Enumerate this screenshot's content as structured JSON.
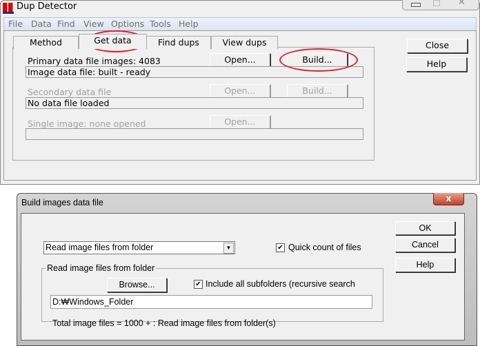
{
  "main_window": {
    "title": "Dup Detector",
    "menu": [
      "File",
      "Data",
      "Find",
      "View",
      "Options",
      "Tools",
      "Help"
    ],
    "tabs": [
      "Method",
      "Get data",
      "Find dups",
      "View dups"
    ],
    "active_tab": "Get data",
    "primary_label": "Primary data file images: 4083",
    "primary_status": "Image data file: built - ready",
    "secondary_label": "Secondary data file",
    "secondary_status": "No data file loaded",
    "single_label": "Single image: none opened",
    "single_status": "",
    "open_label": "Open...",
    "build_label": "Build...",
    "close_label": "Close",
    "help_label": "Help",
    "annotation_color": "#e0202a"
  },
  "dialog": {
    "title": "Build images data file",
    "close_glyph": "x",
    "source_select": "Read image files from folder",
    "quick_count_label": "Quick count of files",
    "quick_count_checked": true,
    "group_label": "Read image files from folder",
    "browse_label": "Browse...",
    "subfolders_label": "Include all subfolders (recursive search",
    "subfolders_checked": true,
    "folder_path": "D:₩Windows_Folder",
    "total_text": "Total image files = 1000 + : Read image files from folder(s)",
    "ok_label": "OK",
    "cancel_label": "Cancel",
    "help_label": "Help"
  }
}
